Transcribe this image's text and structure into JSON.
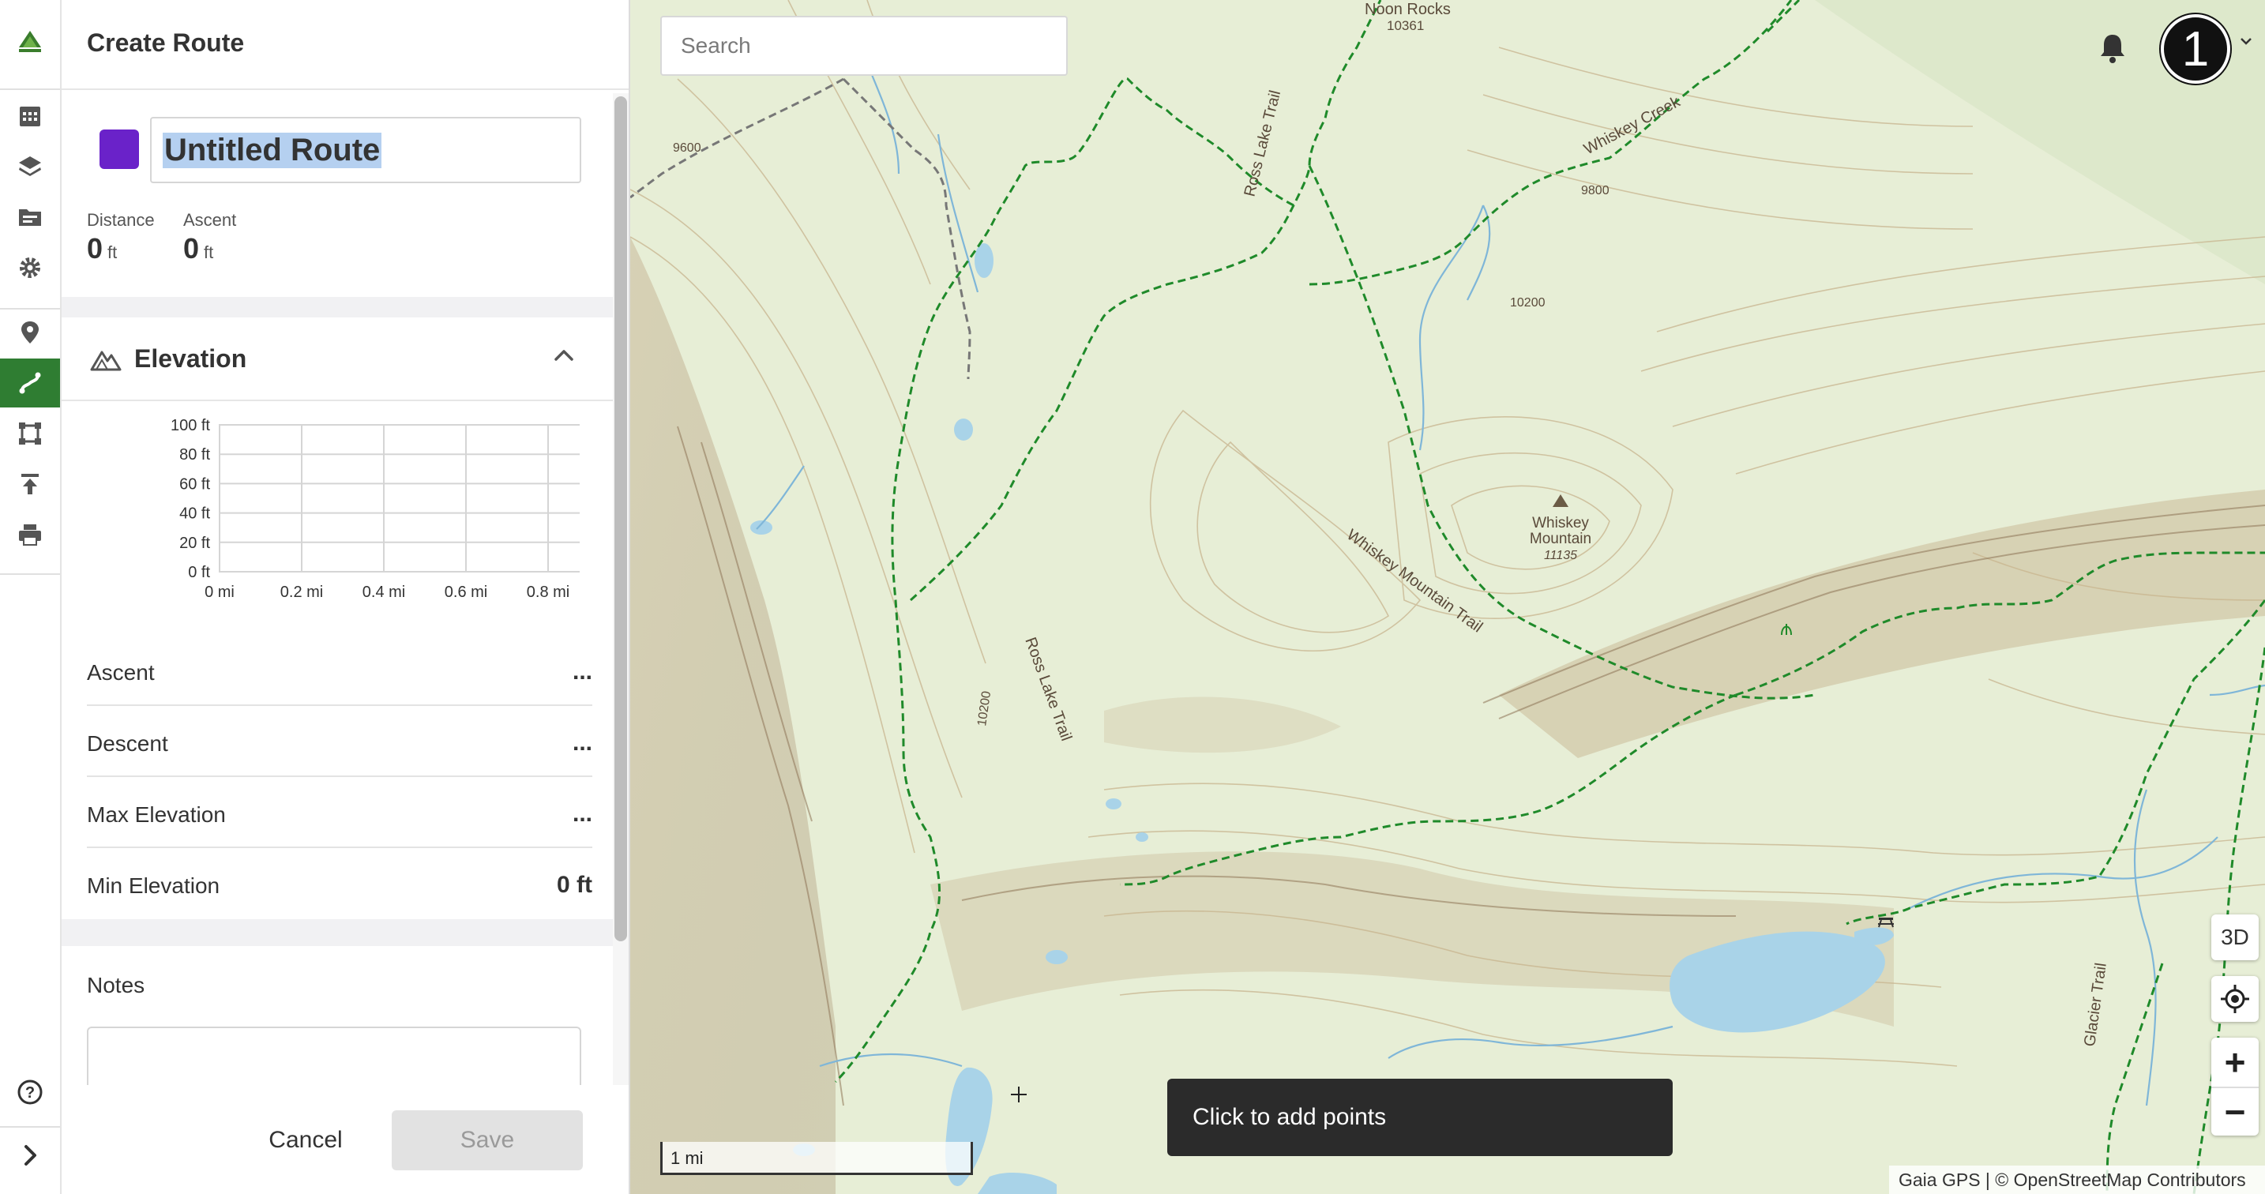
{
  "panel": {
    "title": "Create Route",
    "route_name": "Untitled Route",
    "route_color": "#6a22c9",
    "stats": {
      "distance_label": "Distance",
      "distance_value": "0",
      "distance_unit": "ft",
      "ascent_label": "Ascent",
      "ascent_value": "0",
      "ascent_unit": "ft"
    },
    "elevation": {
      "title": "Elevation",
      "y_ticks": [
        "100 ft",
        "80 ft",
        "60 ft",
        "40 ft",
        "20 ft",
        "0 ft"
      ],
      "x_ticks": [
        "0 mi",
        "0.2 mi",
        "0.4 mi",
        "0.6 mi",
        "0.8 mi"
      ]
    },
    "metrics": [
      {
        "label": "Ascent",
        "value": "..."
      },
      {
        "label": "Descent",
        "value": "..."
      },
      {
        "label": "Max Elevation",
        "value": "..."
      },
      {
        "label": "Min Elevation",
        "value": "0 ft"
      }
    ],
    "notes_label": "Notes",
    "cancel_label": "Cancel",
    "save_label": "Save"
  },
  "rail": {
    "icons": [
      "logo-icon",
      "calendar-icon",
      "layers-icon",
      "folder-icon",
      "settings-icon",
      "waypoint-icon",
      "route-icon",
      "area-icon",
      "upload-icon",
      "print-icon",
      "help-icon",
      "chevron-right-icon"
    ],
    "active": "route-icon",
    "active_color": "#2f7d32"
  },
  "map": {
    "search_placeholder": "Search",
    "avatar_text": "1",
    "btn_3d": "3D",
    "toast": "Click to add points",
    "scale": "1 mi",
    "attribution": "Gaia GPS | © OpenStreetMap Contributors",
    "labels": {
      "noon_rocks": "Noon Rocks",
      "noon_rocks_elev": "10361",
      "whiskey_creek": "Whiskey Creek",
      "ross_lake_trail_1": "Ross Lake Trail",
      "ross_lake_trail_2": "Ross Lake Trail",
      "whiskey_mountain_1": "Whiskey",
      "whiskey_mountain_2": "Mountain",
      "whiskey_mountain_elev": "11135",
      "whiskey_mountain_trail": "Whiskey Mountain Trail",
      "glacier_trail": "Glacier Trail",
      "contour_10200": "10200",
      "contour_9800": "9800",
      "contour_9600": "9600",
      "contour_10200_b": "10200"
    },
    "trail_color": "#1f8a2a"
  }
}
